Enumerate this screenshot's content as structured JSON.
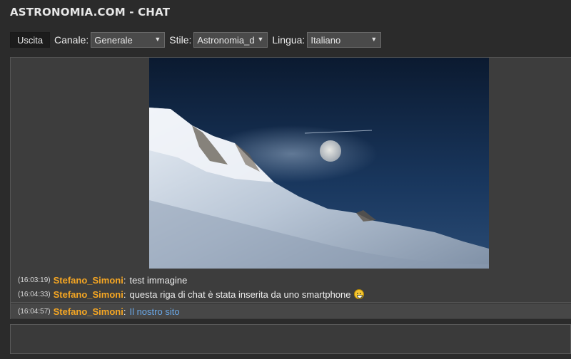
{
  "header": {
    "title": "ASTRONOMIA.COM - CHAT"
  },
  "toolbar": {
    "exit_label": "Uscita",
    "channel_label": "Canale:",
    "channel_value": "Generale",
    "style_label": "Stile:",
    "style_value": "Astronomia_d",
    "language_label": "Lingua:",
    "language_value": "Italiano"
  },
  "messages": [
    {
      "time": "(16:03:19)",
      "user": "Stefano_Simoni",
      "colon": ":",
      "text": "test immagine"
    },
    {
      "time": "(16:04:33)",
      "user": "Stefano_Simoni",
      "colon": ":",
      "text": "questa riga di chat è stata inserita da uno smartphone"
    },
    {
      "time": "(16:04:57)",
      "user": "Stefano_Simoni",
      "colon": ":",
      "link": "Il nostro sito"
    }
  ],
  "icons": {
    "dropdown": "chevron-down-icon",
    "emoji": "grinning-face-icon"
  },
  "colors": {
    "username": "#f5a623",
    "link": "#6aa8e8",
    "background": "#2b2b2b"
  }
}
